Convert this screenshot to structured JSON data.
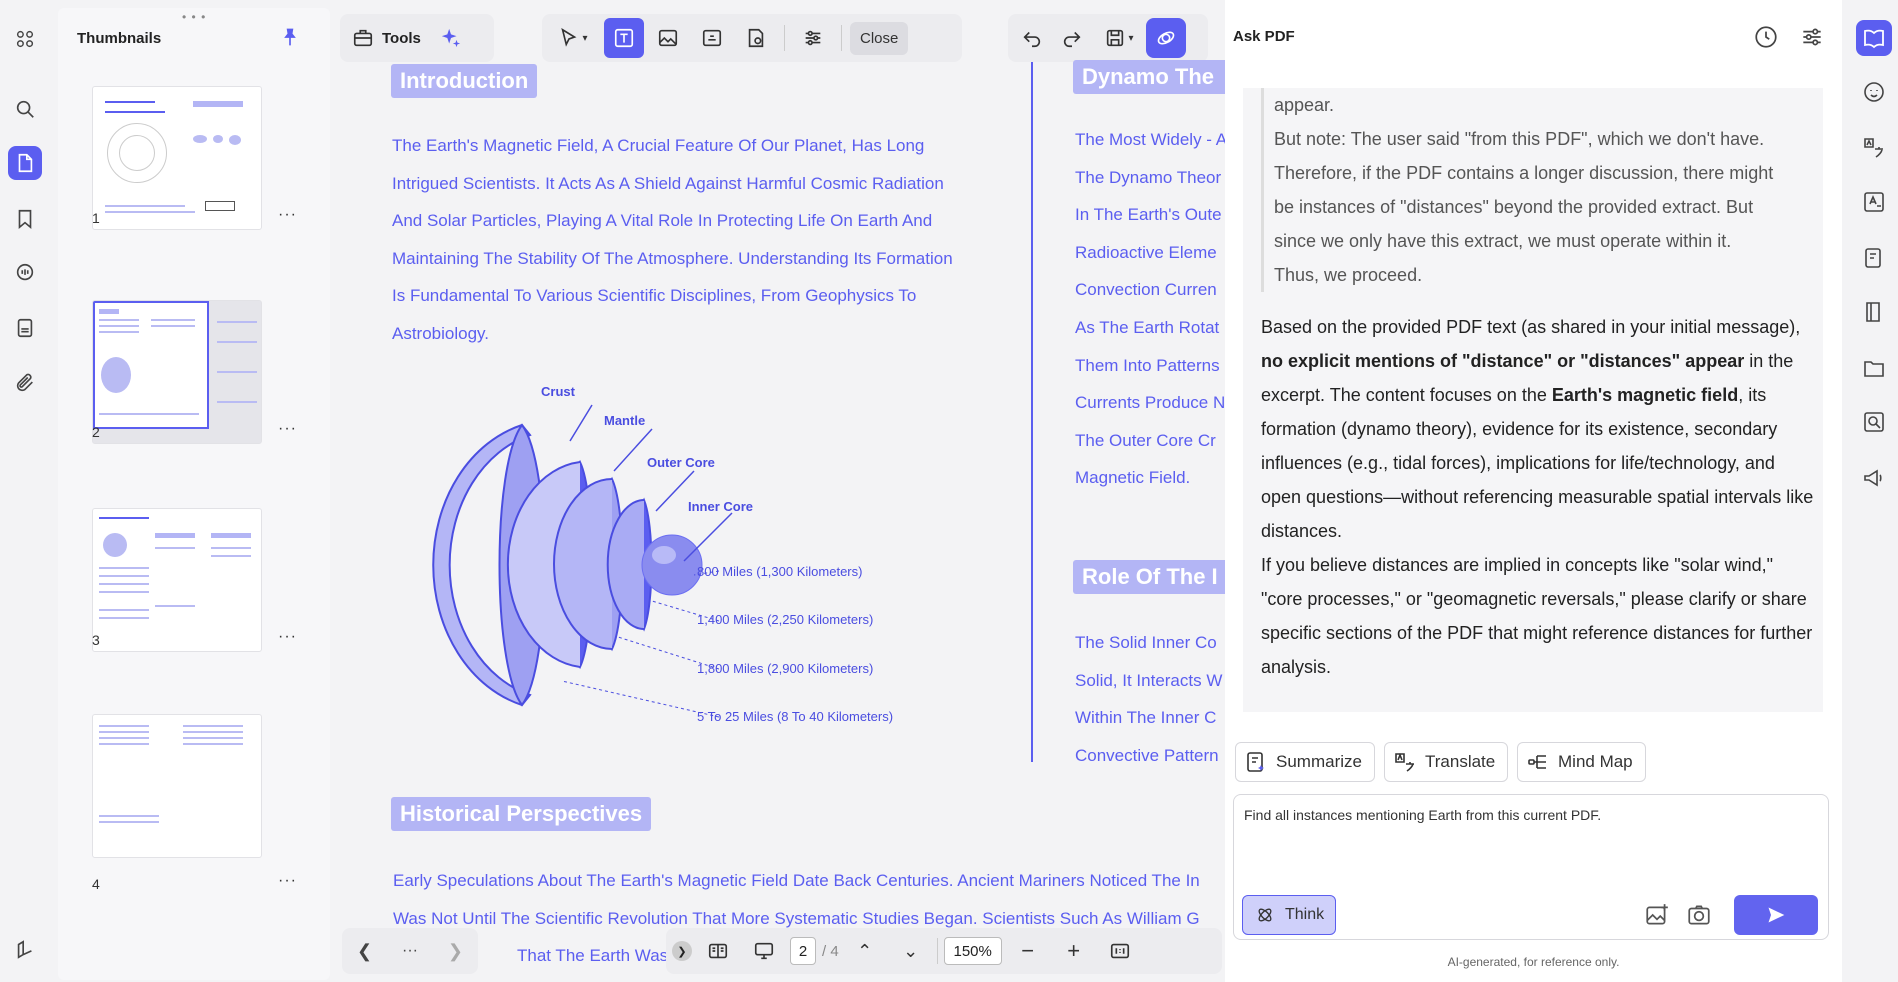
{
  "thumbnails": {
    "title": "Thumbnails",
    "pages": [
      {
        "number": "1",
        "more": "···"
      },
      {
        "number": "2",
        "more": "···"
      },
      {
        "number": "3",
        "more": "···"
      },
      {
        "number": "4",
        "more": "···"
      }
    ]
  },
  "toolbar": {
    "tools_label": "Tools",
    "close_label": "Close"
  },
  "document": {
    "introduction_heading": "Introduction",
    "intro_lines": [
      "The Earth's Magnetic Field, A Crucial Feature Of Our Planet, Has Long",
      "Intrigued Scientists. It Acts As A Shield Against Harmful Cosmic Radiation",
      "And Solar Particles, Playing A Vital Role In Protecting Life On Earth And",
      "Maintaining The Stability Of The Atmosphere. Understanding Its Formation",
      "Is Fundamental To Various Scientific Disciplines, From Geophysics To",
      "Astrobiology."
    ],
    "diagram_labels": {
      "crust": "Crust",
      "mantle": "Mantle",
      "outer_core": "Outer Core",
      "inner_core": "Inner Core",
      "d1": "800 Miles (1,300 Kilometers)",
      "d2": "1,400 Miles (2,250 Kilometers)",
      "d3": "1,800 Miles (2,900 Kilometers)",
      "d4": "5 To 25 Miles (8 To 40 Kilometers)"
    },
    "dynamo_heading": "Dynamo The",
    "dynamo_lines": [
      "The Most Widely - A",
      "The Dynamo Theor",
      "In The Earth's Oute",
      "Radioactive Eleme",
      "Convection Curren",
      "As The Earth Rotat",
      "Them Into Patterns",
      "Currents Produce N",
      "The Outer Core Cr",
      "Magnetic Field."
    ],
    "role_heading": "Role Of The I",
    "role_lines": [
      "The Solid Inner Co",
      "Solid, It Interacts W",
      "Within The Inner C",
      "Convective Pattern"
    ],
    "historical_heading": "Historical Perspectives",
    "historical_lines": [
      "Early Speculations About The Earth's Magnetic Field Date Back Centuries. Ancient Mariners Noticed The In",
      "Was Not Until The Scientific Revolution That More Systematic Studies Began. Scientists Such As William G",
      "That The Earth Was A"
    ]
  },
  "pager": {
    "current_page": "2",
    "total": "/ 4",
    "zoom": "150%",
    "more": "···"
  },
  "ask_pdf": {
    "title": "Ask PDF",
    "quote_lines": [
      "appear.",
      "But note: The user said \"from this PDF\", which we don't have.",
      "Therefore, if the PDF contains a longer discussion, there might",
      "be instances of \"distances\" beyond the provided extract. But",
      "since we only have this extract, we must operate within it.",
      "Thus, we proceed."
    ],
    "answer_p1_a": "Based on the provided PDF text (as shared in your initial message), ",
    "answer_p1_b": "no explicit mentions of \"distance\" or \"distances\" appear",
    "answer_p1_c": " in the excerpt. The content focuses on the ",
    "answer_p1_d": "Earth's magnetic field",
    "answer_p1_e": ", its formation (dynamo theory), evidence for its existence, secondary influences (e.g., tidal forces), implications for life/technology, and open questions—without referencing measurable spatial intervals like distances.",
    "answer_p2": "If you believe distances are implied in concepts like \"solar wind,\" \"core processes,\" or \"geomagnetic reversals,\" please clarify or share specific sections of the PDF that might reference distances for further analysis.",
    "actions": {
      "summarize": "Summarize",
      "translate": "Translate",
      "mind_map": "Mind Map"
    },
    "input_text": "Find all instances mentioning Earth from this current PDF.",
    "think_label": "Think",
    "disclaimer": "AI-generated, for reference only."
  },
  "colors": {
    "accent": "#5b5ef0",
    "heading_bg": "#b3b5f5"
  }
}
